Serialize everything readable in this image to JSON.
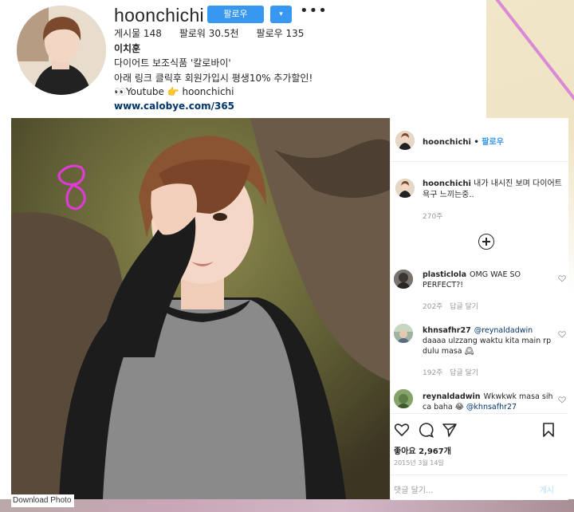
{
  "profile": {
    "username": "hoonchichi",
    "follow_button": "팔로우",
    "dropdown_icon": "▾",
    "more_icon": "•••",
    "stats": {
      "posts": "게시물 148",
      "followers": "팔로워 30.5천",
      "following": "팔로우 135"
    },
    "full_name": "이치훈",
    "bio_line1": "다이어트 보조식품 '칼로바이'",
    "bio_line2": "아래 링크 클릭후 회원가입시 평생10% 추가할인!",
    "bio_line3": "👀Youtube 👉 hoonchichi",
    "link": "www.calobye.com/365"
  },
  "post": {
    "download_label": "Download Photo",
    "annotation_color": "#e23ad9"
  },
  "panel": {
    "header_user": "hoonchichi",
    "header_sep": " • ",
    "header_follow": "팔로우",
    "caption_user": "hoonchichi",
    "caption_text": "내가 내시진 보며 다이어트 욕구 느끼는중..",
    "caption_time": "270주",
    "comments": [
      {
        "user": "plasticlola",
        "text": "OMG WAE SO PERFECT?!",
        "time": "202주",
        "reply": "답글 달기"
      },
      {
        "user": "khnsafhr27",
        "mention": "@reynaldadwin",
        "text": "daaaa ulzzang waktu kita main rp dulu masa 🕰",
        "time": "192주",
        "reply": "답글 달기"
      },
      {
        "user": "reynaldadwin",
        "text": "Wkwkwk masa sih ca baha 😂",
        "mention": "@khnsafhr27"
      }
    ],
    "likes": "좋아요 2,967개",
    "date": "2015년 3월 14일",
    "comment_placeholder": "댓글 달기...",
    "post_button": "게시",
    "accent_color": "#3897f0"
  }
}
